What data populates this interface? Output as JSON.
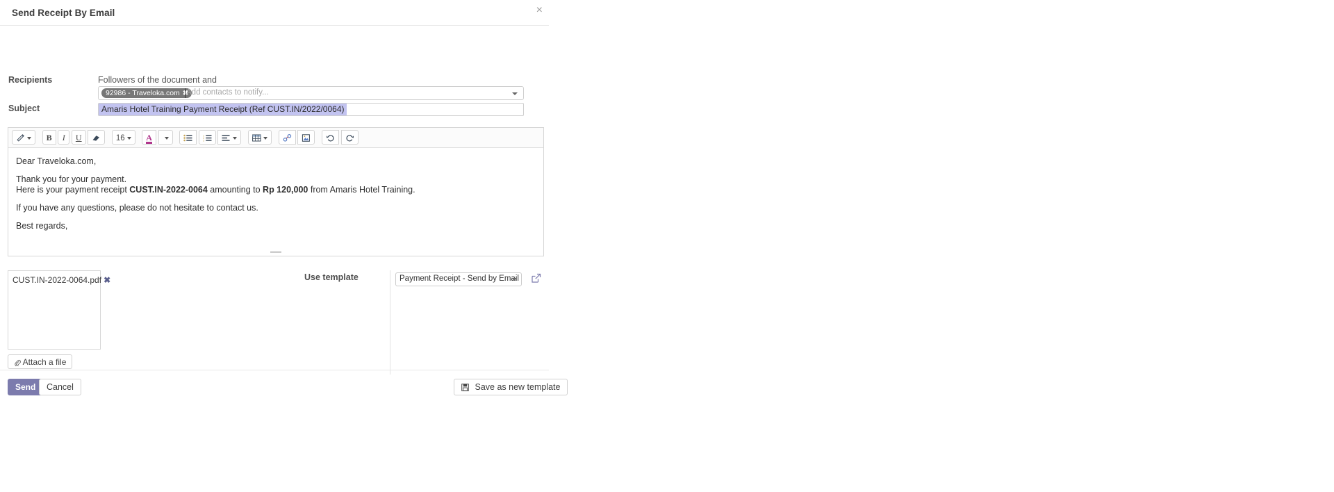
{
  "dialog": {
    "title": "Send Receipt By Email",
    "close_label": "×"
  },
  "form": {
    "recipients_label": "Recipients",
    "followers_text": "Followers of the document and",
    "recipient_tags": [
      {
        "label": "92986 - Traveloka.com",
        "remove_label": "✖"
      }
    ],
    "recipients_placeholder": "Add contacts to notify...",
    "subject_label": "Subject",
    "subject_value": "Amaris Hotel Training Payment Receipt (Ref CUST.IN/2022/0064)"
  },
  "editor": {
    "toolbar": {
      "style_label": "",
      "bold_label": "B",
      "italic_label": "I",
      "underline_label": "U",
      "font_size_value": "16",
      "groups": [
        "style",
        "format",
        "font-size",
        "font-color",
        "lists",
        "table",
        "media",
        "history"
      ]
    },
    "body": {
      "greeting": "Dear Traveloka.com,",
      "thanks": "Thank you for your payment.",
      "receipt_prefix": "Here is your payment receipt ",
      "receipt_ref": "CUST.IN-2022-0064",
      "receipt_middle": " amounting to ",
      "receipt_amount": "Rp 120,000",
      "receipt_suffix": " from Amaris Hotel Training.",
      "questions": "If you have any questions, please do not hesitate to contact us.",
      "signoff": "Best regards,"
    }
  },
  "attachments": {
    "files": [
      {
        "name": "CUST.IN-2022-0064.pdf",
        "remove_label": "✖"
      }
    ],
    "attach_button_label": "Attach a file"
  },
  "template": {
    "label": "Use template",
    "selected": "Payment Receipt - Send by Email"
  },
  "footer": {
    "send_label": "Send",
    "cancel_label": "Cancel",
    "save_template_label": "Save as new template"
  },
  "colors": {
    "accent": "#7c7bad",
    "subject_highlight": "#c2c3f0",
    "tag_bg": "#777777",
    "font_color_icon": "#b0368c"
  }
}
